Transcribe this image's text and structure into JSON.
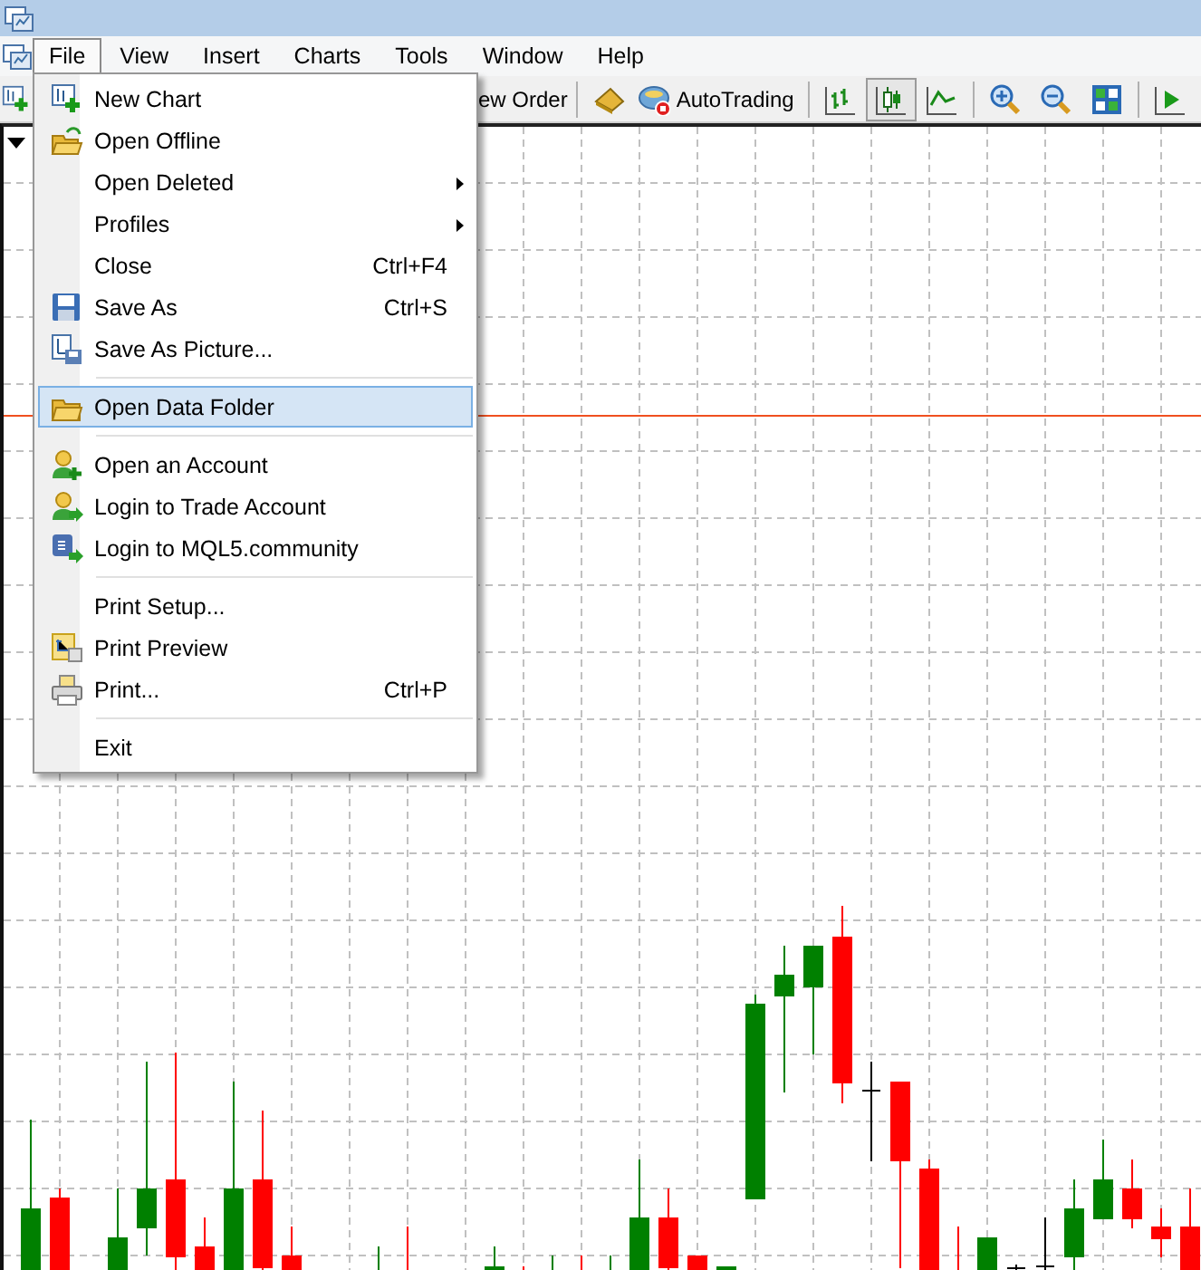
{
  "menu_bar": {
    "items": [
      {
        "label": "File",
        "selected": true
      },
      {
        "label": "View",
        "selected": false
      },
      {
        "label": "Insert",
        "selected": false
      },
      {
        "label": "Charts",
        "selected": false
      },
      {
        "label": "Tools",
        "selected": false
      },
      {
        "label": "Window",
        "selected": false
      },
      {
        "label": "Help",
        "selected": false
      }
    ]
  },
  "toolbar": {
    "order_button": "ew Order",
    "autotrading_button": "AutoTrading",
    "chart_types": [
      {
        "selected": false
      },
      {
        "selected": true
      },
      {
        "selected": false
      }
    ]
  },
  "file_menu": {
    "items": [
      {
        "kind": "item",
        "label": "New Chart",
        "submenu": false,
        "highlighted": false
      },
      {
        "kind": "item",
        "label": "Open Offline",
        "submenu": false,
        "highlighted": false
      },
      {
        "kind": "item",
        "label": "Open Deleted",
        "submenu": true,
        "highlighted": false
      },
      {
        "kind": "item",
        "label": "Profiles",
        "submenu": true,
        "highlighted": false
      },
      {
        "kind": "item",
        "label": "Close",
        "shortcut": "Ctrl+F4",
        "submenu": false,
        "highlighted": false
      },
      {
        "kind": "item",
        "label": "Save As",
        "shortcut": "Ctrl+S",
        "submenu": false,
        "highlighted": false
      },
      {
        "kind": "item",
        "label": "Save As Picture...",
        "submenu": false,
        "highlighted": false
      },
      {
        "kind": "separator"
      },
      {
        "kind": "item",
        "label": "Open Data Folder",
        "submenu": false,
        "highlighted": true
      },
      {
        "kind": "separator"
      },
      {
        "kind": "item",
        "label": "Open an Account",
        "submenu": false,
        "highlighted": false
      },
      {
        "kind": "item",
        "label": "Login to Trade Account",
        "submenu": false,
        "highlighted": false
      },
      {
        "kind": "item",
        "label": "Login to MQL5.community",
        "submenu": false,
        "highlighted": false
      },
      {
        "kind": "separator"
      },
      {
        "kind": "item",
        "label": "Print Setup...",
        "submenu": false,
        "highlighted": false
      },
      {
        "kind": "item",
        "label": "Print Preview",
        "submenu": false,
        "highlighted": false
      },
      {
        "kind": "item",
        "label": "Print...",
        "shortcut": "Ctrl+P",
        "submenu": false,
        "highlighted": false
      },
      {
        "kind": "separator"
      },
      {
        "kind": "item",
        "label": "Exit",
        "submenu": false,
        "highlighted": false
      }
    ]
  }
}
